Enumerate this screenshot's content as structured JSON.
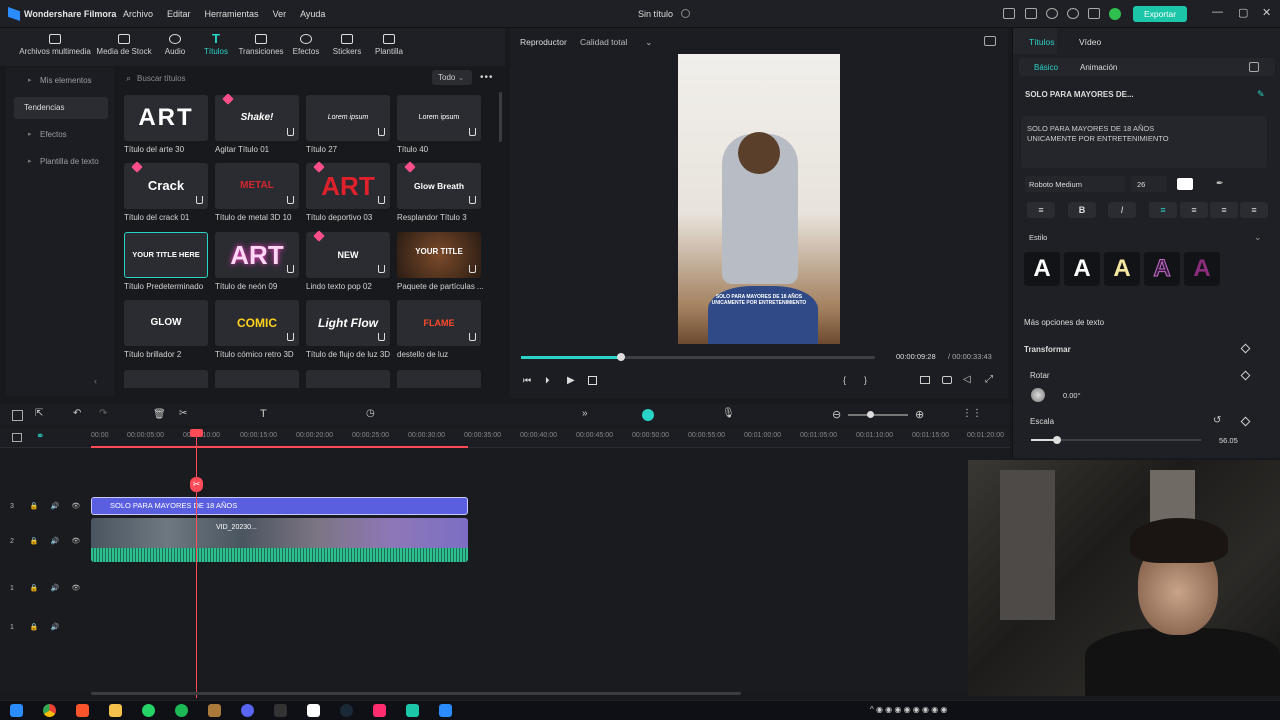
{
  "app": {
    "name": "Wondershare Filmora",
    "doc_title": "Sin título",
    "export_label": "Exportar"
  },
  "menu": [
    "Archivo",
    "Editar",
    "Herramientas",
    "Ver",
    "Ayuda"
  ],
  "toolbar": [
    "Archivos multimedia",
    "Media de Stock",
    "Audio",
    "Títulos",
    "Transiciones",
    "Efectos",
    "Stickers",
    "Plantilla"
  ],
  "leftnav": [
    {
      "label": "Mis elementos"
    },
    {
      "label": "Tendencias"
    },
    {
      "label": "Efectos"
    },
    {
      "label": "Plantilla de texto"
    }
  ],
  "search": {
    "placeholder": "Buscar títulos",
    "filter": "Todo"
  },
  "titles": [
    {
      "thumb": "ART",
      "caption": "Título del arte 30"
    },
    {
      "thumb": "Shake!",
      "caption": "Agitar Título 01"
    },
    {
      "thumb": "Lorem ipsum",
      "caption": "Título 27"
    },
    {
      "thumb": "Lorem ipsum",
      "caption": "Título 40"
    },
    {
      "thumb": "Crack",
      "caption": "Título del crack 01"
    },
    {
      "thumb": "METAL",
      "caption": "Título de metal 3D 10"
    },
    {
      "thumb": "ART",
      "caption": "Título deportivo 03"
    },
    {
      "thumb": "Glow Breath",
      "caption": "Resplandor Título 3"
    },
    {
      "thumb": "YOUR TITLE HERE",
      "caption": "Título Predeterminado"
    },
    {
      "thumb": "ART",
      "caption": "Título de neón 09"
    },
    {
      "thumb": "NEW",
      "caption": "Lindo texto pop 02"
    },
    {
      "thumb": "YOUR TITLE",
      "caption": "Paquete de partículas ..."
    },
    {
      "thumb": "GLOW",
      "caption": "Título brillador 2"
    },
    {
      "thumb": "COMIC",
      "caption": "Título cómico retro 3D"
    },
    {
      "thumb": "Light Flow",
      "caption": "Título de flujo de luz 3D"
    },
    {
      "thumb": "FLAME",
      "caption": "destello de luz"
    }
  ],
  "player": {
    "tab": "Reproductor",
    "quality": "Calidad total",
    "overlay_text": "SOLO PARA MAYORES DE 18 AÑOS\nUNICAMENTE POR ENTRETENIMIENTO",
    "current_time": "00:00:09:28",
    "total_time": "/ 00:00:33:43",
    "progress": 0.28
  },
  "properties": {
    "tabs": [
      "Títulos",
      "Vídeo"
    ],
    "subtabs": [
      "Básico",
      "Animación"
    ],
    "header": "SOLO PARA MAYORES DE...",
    "text_line1": "SOLO PARA MAYORES DE 18 AÑOS",
    "text_line2": "UNICAMENTE POR ENTRETENIMIENTO",
    "font": "Roboto Medium",
    "font_size": "26",
    "style_label": "Estilo",
    "more_options": "Más opciones de texto",
    "transform": "Transformar",
    "rotate_label": "Rotar",
    "rotate_value": "0.00°",
    "scale_label": "Escala",
    "scale_value": "56.05"
  },
  "timeline": {
    "ticks": [
      "00:00",
      "00:00:05:00",
      "00:00:10:00",
      "00:00:15:00",
      "00:00:20:00",
      "00:00:25:00",
      "00:00:30:00",
      "00:00:35:00",
      "00:00:40:00",
      "00:00:45:00",
      "00:00:50:00",
      "00:00:55:00",
      "00:01:00:00",
      "00:01:05:00",
      "00:01:10:00",
      "00:01:15:00",
      "00:01:20:00"
    ],
    "title_clip": "SOLO PARA MAYORES DE 18 AÑOS",
    "video_clip": "VID_20230...",
    "track_numbers": [
      "3",
      "2",
      "1",
      "1"
    ]
  }
}
